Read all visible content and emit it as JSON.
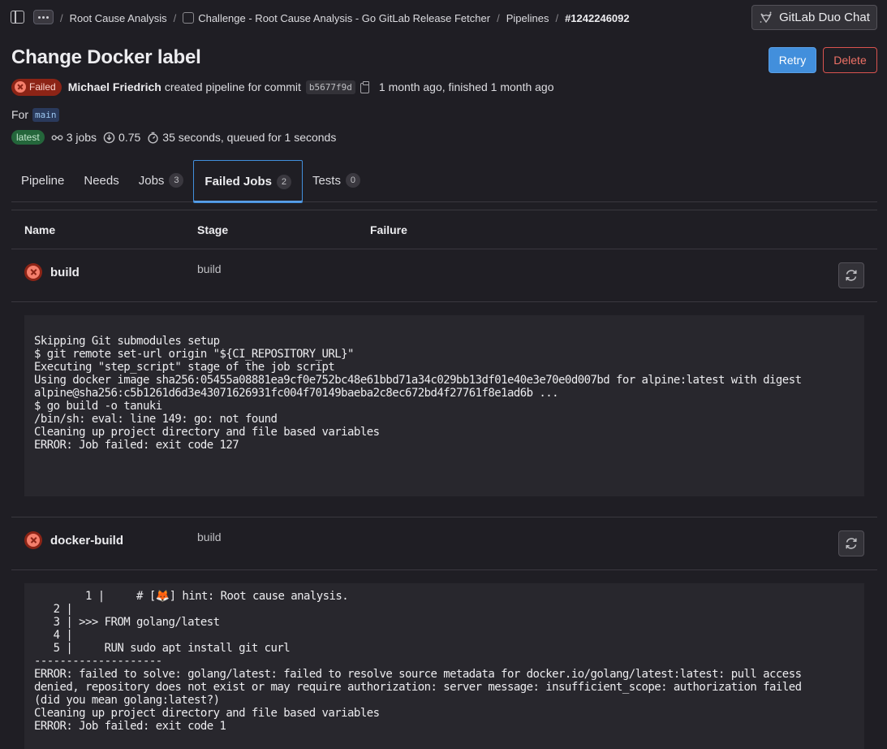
{
  "breadcrumbs": [
    {
      "label": "Root Cause Analysis"
    },
    {
      "label": "Challenge - Root Cause Analysis - Go GitLab Release Fetcher",
      "icon": "project-icon"
    },
    {
      "label": "Pipelines"
    },
    {
      "label": "#1242246092"
    }
  ],
  "duo_chat_label": "GitLab Duo Chat",
  "page": {
    "title": "Change Docker label",
    "retry_label": "Retry",
    "delete_label": "Delete"
  },
  "pipeline": {
    "status": "Failed",
    "author": "Michael Friedrich",
    "action_text": "created pipeline for commit",
    "commit_sha": "b5677f9d",
    "time_text": "1 month ago, finished 1 month ago",
    "for_label": "For",
    "branch": "main",
    "latest_badge": "latest",
    "jobs_count": "3 jobs",
    "coverage": "0.75",
    "duration": "35 seconds, queued for 1 seconds"
  },
  "tabs": [
    {
      "label": "Pipeline",
      "count": null
    },
    {
      "label": "Needs",
      "count": null
    },
    {
      "label": "Jobs",
      "count": "3"
    },
    {
      "label": "Failed Jobs",
      "count": "2",
      "active": true
    },
    {
      "label": "Tests",
      "count": "0"
    }
  ],
  "table": {
    "headers": {
      "name": "Name",
      "stage": "Stage",
      "failure": "Failure"
    },
    "jobs": [
      {
        "name": "build",
        "stage": "build",
        "log": "Skipping Git submodules setup\n$ git remote set-url origin \"${CI_REPOSITORY_URL}\"\nExecuting \"step_script\" stage of the job script\nUsing docker image sha256:05455a08881ea9cf0e752bc48e61bbd71a34c029bb13df01e40e3e70e0d007bd for alpine:latest with digest\nalpine@sha256:c5b1261d6d3e43071626931fc004f70149baeba2c8ec672bd4f27761f8e1ad6b ...\n$ go build -o tanuki\n/bin/sh: eval: line 149: go: not found\nCleaning up project directory and file based variables\nERROR: Job failed: exit code 127"
      },
      {
        "name": "docker-build",
        "stage": "build",
        "log": "        1 |     # [🦊] hint: Root cause analysis.\n   2 |\n   3 | >>> FROM golang/latest\n   4 |\n   5 |     RUN sudo apt install git curl\n--------------------\nERROR: failed to solve: golang/latest: failed to resolve source metadata for docker.io/golang/latest:latest: pull access\ndenied, repository does not exist or may require authorization: server message: insufficient_scope: authorization failed\n(did you mean golang:latest?)\nCleaning up project directory and file based variables\nERROR: Job failed: exit code 1"
      }
    ]
  }
}
